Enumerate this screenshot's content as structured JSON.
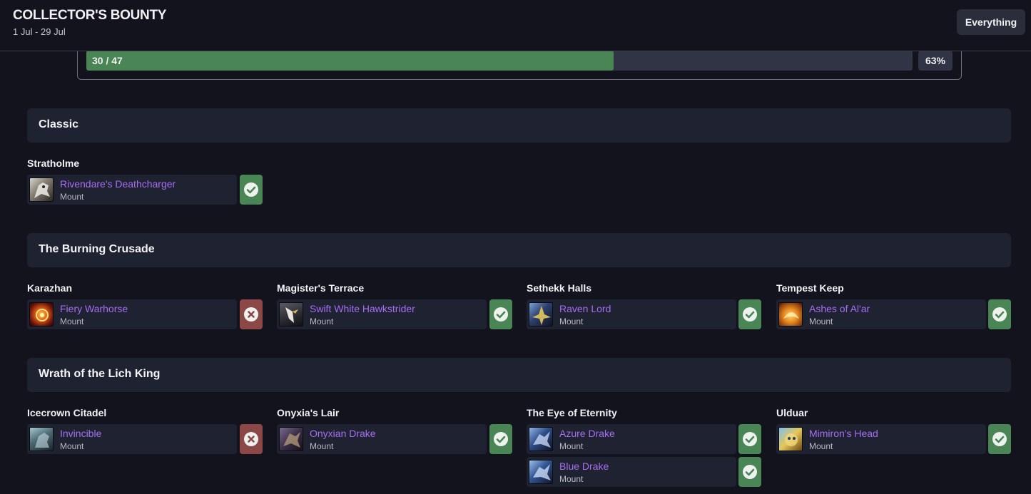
{
  "header": {
    "title": "COLLECTOR'S BOUNTY",
    "dates": "1 Jul - 29 Jul",
    "filter_label": "Everything"
  },
  "progress": {
    "label": "30 / 47",
    "percent_label": "63%",
    "fraction": 0.638
  },
  "colors": {
    "background": "#12131d",
    "card": "#1f2230",
    "accent_green": "#4a8555",
    "accent_red": "#8c4747",
    "item_name": "#a56ff2"
  },
  "sections": [
    {
      "title": "Classic",
      "dungeons": [
        {
          "name": "Stratholme",
          "items": [
            {
              "name": "Rivendare's Deathcharger",
              "type": "Mount",
              "icon": "skeletal-horse-icon",
              "status": "collected"
            }
          ]
        }
      ]
    },
    {
      "title": "The Burning Crusade",
      "dungeons": [
        {
          "name": "Karazhan",
          "items": [
            {
              "name": "Fiery Warhorse",
              "type": "Mount",
              "icon": "fiery-horse-icon",
              "status": "missing"
            }
          ]
        },
        {
          "name": "Magister's Terrace",
          "items": [
            {
              "name": "Swift White Hawkstrider",
              "type": "Mount",
              "icon": "hawkstrider-icon",
              "status": "collected"
            }
          ]
        },
        {
          "name": "Sethekk Halls",
          "items": [
            {
              "name": "Raven Lord",
              "type": "Mount",
              "icon": "raven-icon",
              "status": "collected"
            }
          ]
        },
        {
          "name": "Tempest Keep",
          "items": [
            {
              "name": "Ashes of Al'ar",
              "type": "Mount",
              "icon": "phoenix-icon",
              "status": "collected"
            }
          ]
        }
      ]
    },
    {
      "title": "Wrath of the Lich King",
      "dungeons": [
        {
          "name": "Icecrown Citadel",
          "items": [
            {
              "name": "Invincible",
              "type": "Mount",
              "icon": "frost-horse-icon",
              "status": "missing"
            }
          ]
        },
        {
          "name": "Onyxia's Lair",
          "items": [
            {
              "name": "Onyxian Drake",
              "type": "Mount",
              "icon": "black-drake-icon",
              "status": "collected"
            }
          ]
        },
        {
          "name": "The Eye of Eternity",
          "items": [
            {
              "name": "Azure Drake",
              "type": "Mount",
              "icon": "azure-drake-icon",
              "status": "collected"
            },
            {
              "name": "Blue Drake",
              "type": "Mount",
              "icon": "blue-drake-icon",
              "status": "collected"
            }
          ]
        },
        {
          "name": "Ulduar",
          "items": [
            {
              "name": "Mimiron's Head",
              "type": "Mount",
              "icon": "mechanical-head-icon",
              "status": "collected"
            }
          ]
        }
      ]
    }
  ]
}
